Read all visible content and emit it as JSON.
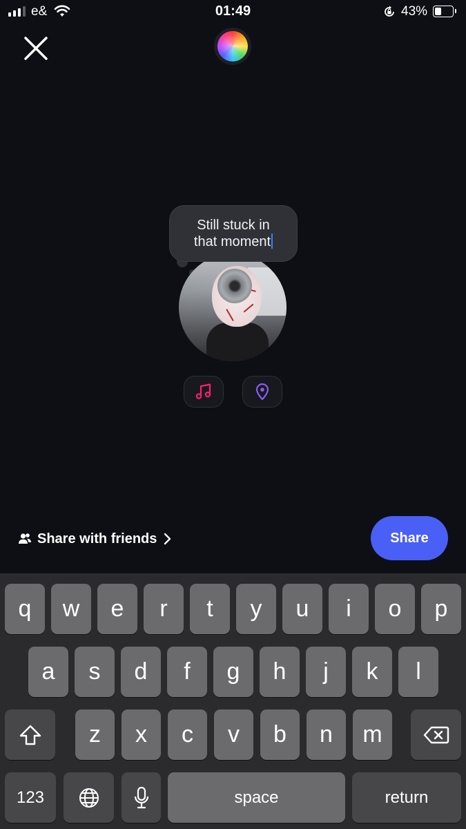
{
  "status_bar": {
    "carrier": "e&",
    "time": "01:49",
    "battery_percent": "43%",
    "battery_level": 0.43,
    "signal_bars": 3
  },
  "header": {
    "close_icon": "close-icon",
    "color_picker_icon": "color-orb-icon"
  },
  "note": {
    "line1": "Still stuck in",
    "line2": "that moment"
  },
  "attachments": {
    "music_icon": "music-note-icon",
    "music_color": "#ff1f6e",
    "location_icon": "location-pin-icon",
    "location_color": "#8b5cf6"
  },
  "share_row": {
    "audience_label": "Share with friends",
    "share_label": "Share",
    "share_color": "#4a5ff5"
  },
  "keyboard": {
    "row1": [
      "q",
      "w",
      "e",
      "r",
      "t",
      "y",
      "u",
      "i",
      "o",
      "p"
    ],
    "row2": [
      "a",
      "s",
      "d",
      "f",
      "g",
      "h",
      "j",
      "k",
      "l"
    ],
    "row3": [
      "z",
      "x",
      "c",
      "v",
      "b",
      "n",
      "m"
    ],
    "numbers_label": "123",
    "space_label": "space",
    "return_label": "return"
  }
}
